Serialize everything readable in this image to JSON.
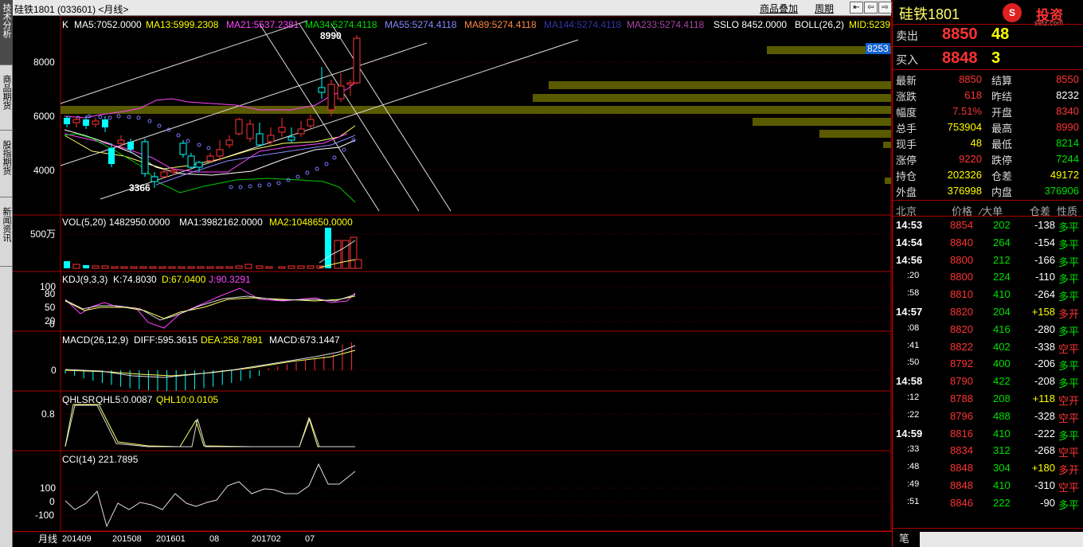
{
  "window": {
    "title": "硅铁1801 (033601) <月线>",
    "btn_overlay": "商品叠加",
    "btn_period": "周期"
  },
  "sidetabs": [
    {
      "label": "技术分析",
      "active": true
    },
    {
      "label": "商品期货"
    },
    {
      "label": "股指期货"
    },
    {
      "label": "新闻资讯"
    }
  ],
  "main": {
    "k_label": "K",
    "ma5": "MA5:7052.0000",
    "ma13": "MA13:5999.2308",
    "ma21": "MA21:5537.2381",
    "ma34": "MA34:5274.4118",
    "ma55": "MA55:5274.4118",
    "ma89": "MA89:5274.4118",
    "ma144": "MA144:5274.4118",
    "ma233": "MA233:5274.4118",
    "sslo": "SSLO  8452.0000",
    "boll": "BOLL(26,2)",
    "mid": "MID:5239",
    "high_mark": "8990",
    "low_mark": "3366",
    "price_tag": "8253",
    "y_labels": [
      "8000",
      "6000",
      "4000"
    ]
  },
  "vol": {
    "title": "VOL(5,20)  1482950.0000",
    "ma1": "MA1:3982162.0000",
    "ma2": "MA2:1048650.0000",
    "y_label": "500万"
  },
  "kdj": {
    "title": "KDJ(9,3,3)",
    "k": "K:74.8030",
    "d": "D:67.0400",
    "j": "J:90.3291",
    "y_labels": [
      "100",
      "80",
      "50",
      "20",
      "0"
    ]
  },
  "macd": {
    "title": "MACD(26,12,9)",
    "diff": "DIFF:595.3615",
    "dea": "DEA:258.7891",
    "macd": "MACD:673.1447",
    "y_label": "0"
  },
  "qhl": {
    "title": "QHLSR",
    "qhl5": "QHL5:0.0087",
    "qhl10": "QHL10:0.0105",
    "y_label": "0.8"
  },
  "cci": {
    "title": "CCI(14)  221.7895",
    "y_labels": [
      "100",
      "0",
      "-100"
    ]
  },
  "xaxis": {
    "period": "月线",
    "labels": [
      "201409",
      "201508",
      "201601",
      "08",
      "201702",
      "07"
    ]
  },
  "quote": {
    "name": "硅铁1801",
    "sell_label": "卖出",
    "sell_price": "8850",
    "sell_vol": "48",
    "buy_label": "买入",
    "buy_price": "8848",
    "buy_vol": "3",
    "stats": [
      [
        "最新",
        "8850",
        "结算",
        "8550"
      ],
      [
        "涨跌",
        "618",
        "昨结",
        "8232"
      ],
      [
        "幅度",
        "7.51%",
        "开盘",
        "8340"
      ],
      [
        "总手",
        "753904",
        "最高",
        "8990"
      ],
      [
        "现手",
        "48",
        "最低",
        "8214"
      ],
      [
        "涨停",
        "9220",
        "跌停",
        "7244"
      ],
      [
        "持仓",
        "202326",
        "仓差",
        "49172"
      ],
      [
        "外盘",
        "376998",
        "内盘",
        "376906"
      ]
    ],
    "tick_headers": [
      "北京",
      "价格",
      "⁄大单",
      "仓差",
      "性质"
    ],
    "ticks": [
      [
        "14:53",
        "8854",
        "202",
        "-138",
        "多平"
      ],
      [
        "14:54",
        "8840",
        "264",
        "-154",
        "多平"
      ],
      [
        "14:56",
        "8800",
        "212",
        "-166",
        "多平"
      ],
      [
        ":20",
        "8800",
        "224",
        "-110",
        "多平"
      ],
      [
        ":58",
        "8810",
        "410",
        "-264",
        "多平"
      ],
      [
        "14:57",
        "8820",
        "204",
        "+158",
        "多开"
      ],
      [
        ":08",
        "8820",
        "416",
        "-280",
        "多平"
      ],
      [
        ":41",
        "8822",
        "402",
        "-338",
        "空平"
      ],
      [
        ":50",
        "8792",
        "400",
        "-206",
        "多平"
      ],
      [
        "14:58",
        "8790",
        "422",
        "-208",
        "多平"
      ],
      [
        ":12",
        "8788",
        "208",
        "+118",
        "空开"
      ],
      [
        ":22",
        "8796",
        "488",
        "-328",
        "空平"
      ],
      [
        "14:59",
        "8816",
        "410",
        "-222",
        "多平"
      ],
      [
        ":33",
        "8834",
        "312",
        "-268",
        "空平"
      ],
      [
        ":48",
        "8848",
        "304",
        "+180",
        "多开"
      ],
      [
        ":49",
        "8848",
        "410",
        "-310",
        "空平"
      ],
      [
        ":51",
        "8846",
        "222",
        "-90",
        "多平"
      ]
    ],
    "note_label": "笔"
  },
  "logo": {
    "text": "投资",
    "site": "setz.com"
  },
  "colors": {
    "up": "#ff3333",
    "down": "#00ffff",
    "grid": "#aa0000"
  }
}
